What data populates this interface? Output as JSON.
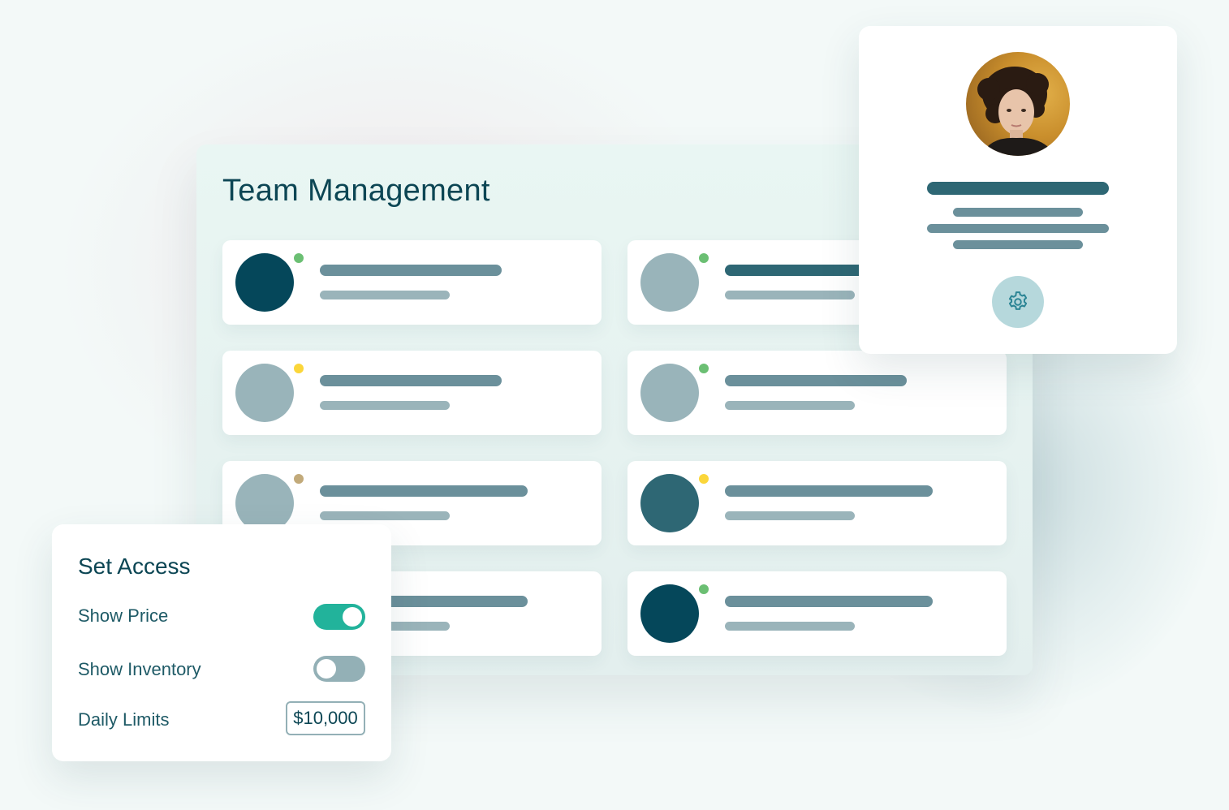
{
  "team": {
    "title": "Team Management",
    "members": [
      {
        "avatar_color": "#05475a",
        "status_color": "#6bbf73"
      },
      {
        "avatar_color": "#99b4ba",
        "status_color": "#6bbf73"
      },
      {
        "avatar_color": "#99b4ba",
        "status_color": "#fbd63a"
      },
      {
        "avatar_color": "#99b4ba",
        "status_color": "#6bbf73"
      },
      {
        "avatar_color": "#99b4ba",
        "status_color": "#c2aa7a"
      },
      {
        "avatar_color": "#2e6774",
        "status_color": "#fbd63a"
      },
      {
        "avatar_color": "#99b4ba",
        "status_color": "#6bbf73"
      },
      {
        "avatar_color": "#05475a",
        "status_color": "#6bbf73"
      }
    ]
  },
  "profile": {
    "settings_icon": "gear-icon"
  },
  "access": {
    "title": "Set Access",
    "show_price_label": "Show Price",
    "show_price_on": true,
    "show_inventory_label": "Show Inventory",
    "show_inventory_on": false,
    "daily_limits_label": "Daily Limits",
    "daily_limits_value": "$10,000"
  },
  "colors": {
    "brand_dark": "#0c4654",
    "toggle_on": "#22b39b",
    "toggle_off": "#93b0b6"
  }
}
